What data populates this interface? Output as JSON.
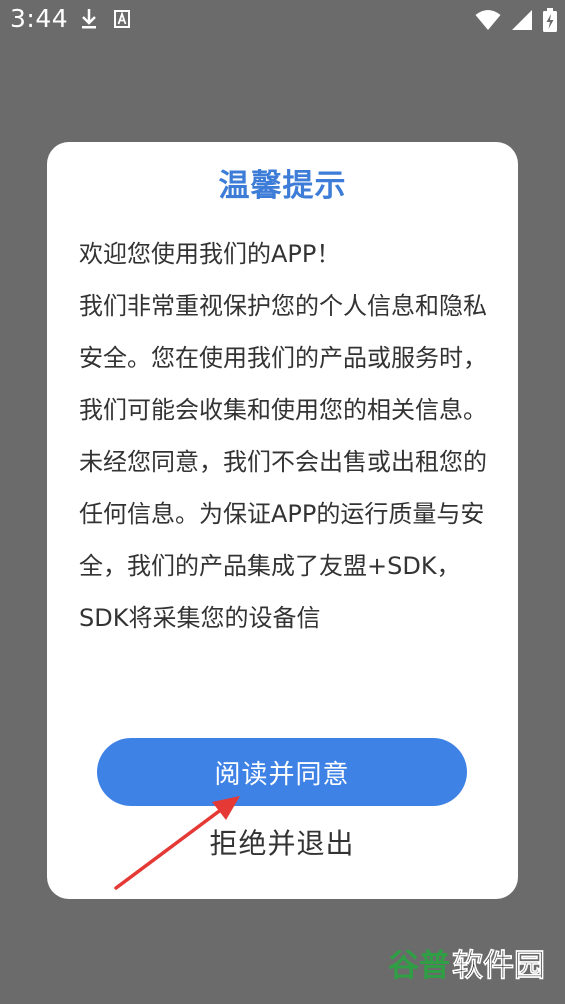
{
  "status_bar": {
    "time": "3:44",
    "icons": [
      "download-icon",
      "a-badge-icon",
      "wifi-icon",
      "signal-icon",
      "battery-charging-icon"
    ]
  },
  "dialog": {
    "title": "温馨提示",
    "body_paragraphs": [
      "欢迎您使用我们的APP！",
      "我们非常重视保护您的个人信息和隐私安全。您在使用我们的产品或服务时，我们可能会收集和使用您的相关信息。未经您同意，我们不会出售或出租您的任何信息。为保证APP的运行质量与安全，我们的产品集成了友盟+SDK，SDK将采集您的设备信"
    ],
    "agree_label": "阅读并同意",
    "reject_label": "拒绝并退出"
  },
  "watermark": {
    "text": "谷普软件园"
  },
  "colors": {
    "title": "#3d7dd8",
    "agree_button": "#3e82e6",
    "annotation_arrow": "#e53935"
  }
}
